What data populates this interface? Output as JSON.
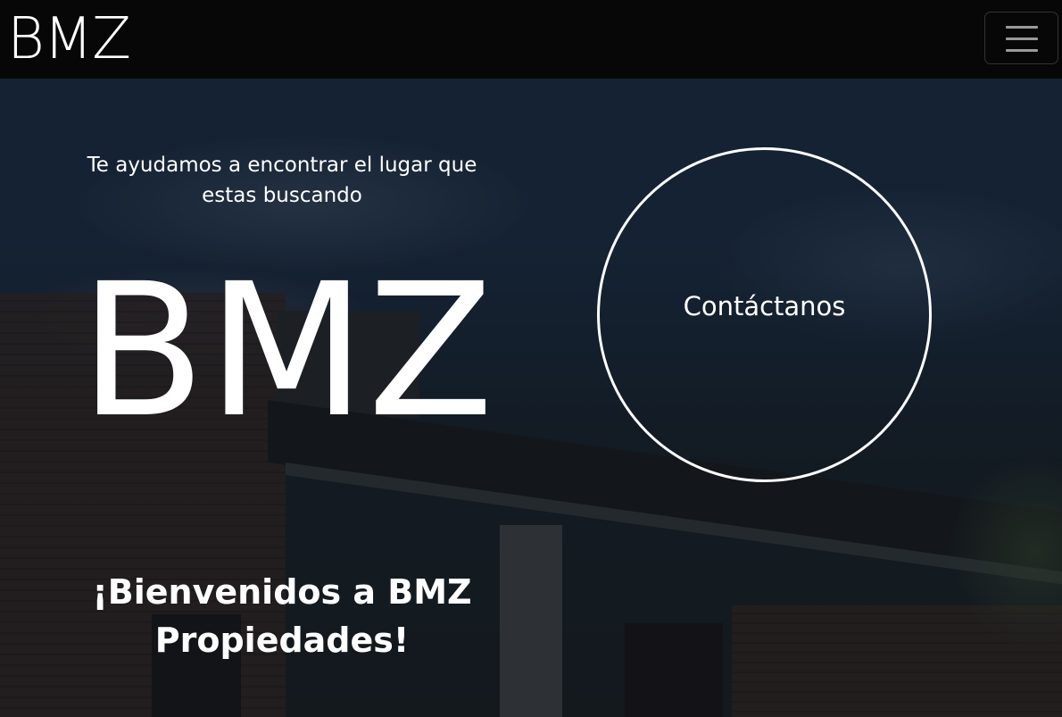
{
  "navbar": {
    "brand": "BMZ",
    "toggler_icon": "hamburger-menu-icon"
  },
  "hero": {
    "tagline": "Te ayudamos a encontrar el lugar que estas buscando",
    "logo_text": "BMZ",
    "welcome": "¡Bienvenidos a BMZ Propiedades!",
    "contact_button": "Contáctanos"
  },
  "colors": {
    "navbar_bg": "#070707",
    "text": "#ffffff",
    "toggler_border": "#333333"
  }
}
